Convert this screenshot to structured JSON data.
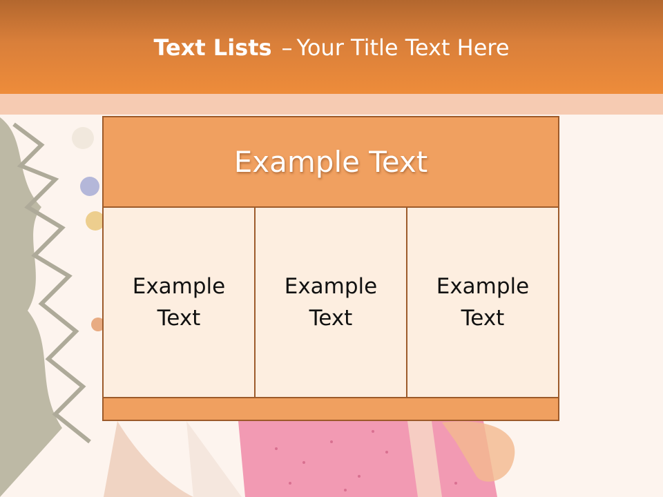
{
  "title": {
    "bold": "Text Lists",
    "separator": "–",
    "rest": "Your Title Text Here"
  },
  "table": {
    "header": "Example Text",
    "cells": [
      "Example Text",
      "Example Text",
      "Example Text"
    ]
  },
  "colors": {
    "title_bar": "#e0853a",
    "header_fill": "#f0a060",
    "cell_fill": "#fdeee0",
    "border": "#9c5a2a"
  }
}
